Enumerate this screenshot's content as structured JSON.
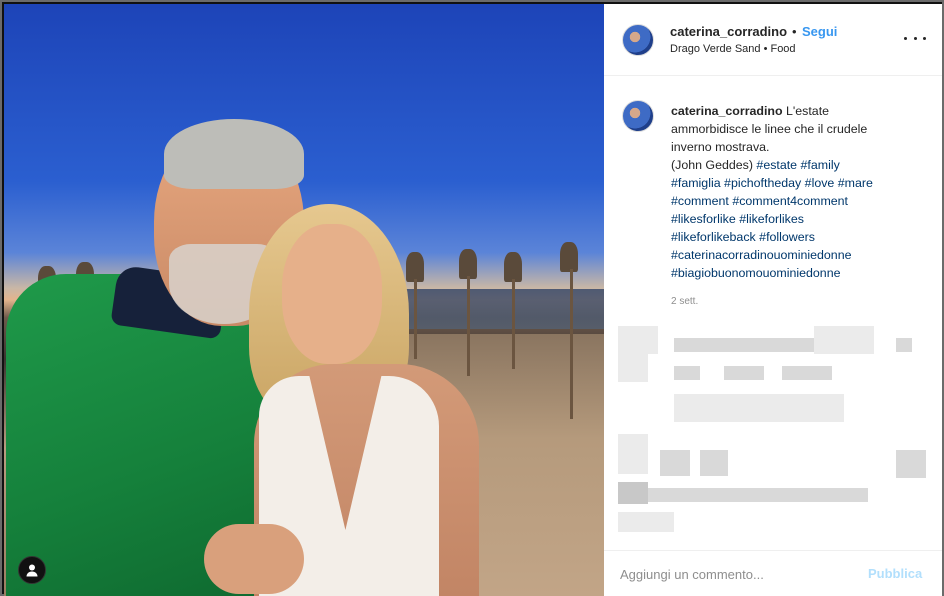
{
  "post": {
    "username": "caterina_corradino",
    "separator": "•",
    "follow_label": "Segui",
    "location": "Drago Verde Sand • Food",
    "more_icon": "more-horizontal-icon"
  },
  "caption": {
    "username": "caterina_corradino",
    "text_line1": "L'estate",
    "text_line2": "ammorbidisce le linee che il crudele",
    "text_line3": "inverno mostrava.",
    "author": "(John Geddes)",
    "hashtags": [
      "#estate",
      "#family",
      "#famiglia",
      "#pichoftheday",
      "#love",
      "#mare",
      "#comment",
      "#comment4comment",
      "#likesforlike",
      "#likeforlikes",
      "#likeforlikeback",
      "#followers",
      "#caterinacorradinouominiedonne",
      "#biagiobuonomouominiedonne"
    ],
    "time_ago": "2 sett."
  },
  "comment_box": {
    "placeholder": "Aggiungi un commento...",
    "publish_label": "Pubblica"
  },
  "colors": {
    "link_blue": "#3897f0",
    "hashtag": "#00376b",
    "publish_disabled": "#b2dffc",
    "shirt_green": "#1f9a4a"
  }
}
